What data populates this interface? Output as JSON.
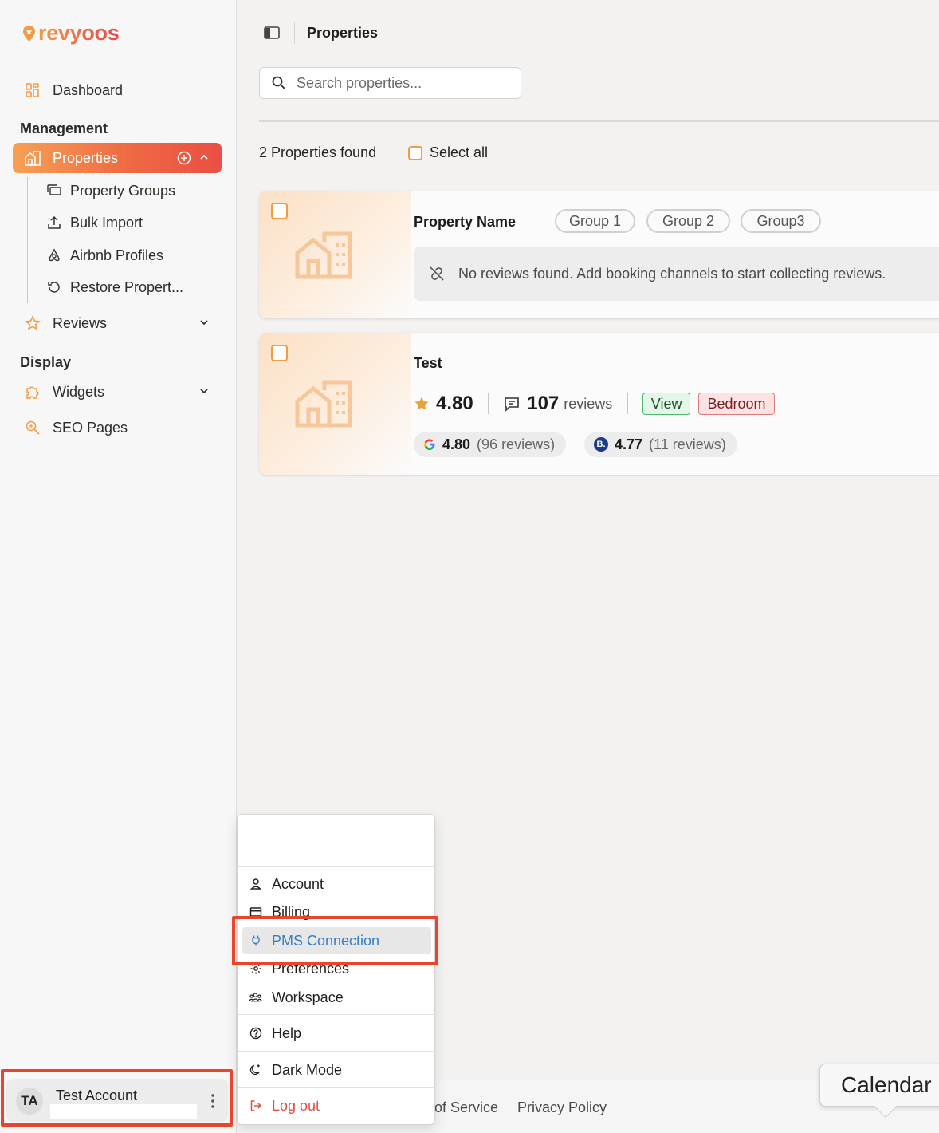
{
  "app": {
    "logo_text": "revyoos",
    "brand_color": "#f07a3a"
  },
  "sidebar": {
    "dashboard_label": "Dashboard",
    "management_title": "Management",
    "properties_label": "Properties",
    "sub_items": [
      "Property Groups",
      "Bulk Import",
      "Airbnb Profiles",
      "Restore Propert..."
    ],
    "reviews_label": "Reviews",
    "display_title": "Display",
    "widgets_label": "Widgets",
    "seo_label": "SEO Pages",
    "account": {
      "initials": "TA",
      "name": "Test Account"
    }
  },
  "header": {
    "title": "Properties"
  },
  "search": {
    "placeholder": "Search properties..."
  },
  "list": {
    "count_text": "2 Properties found",
    "select_all_label": "Select all"
  },
  "properties": [
    {
      "name": "Property Name",
      "groups": [
        "Group 1",
        "Group 2",
        "Group3"
      ],
      "notice": "No reviews found. Add booking channels to start collecting reviews."
    },
    {
      "name": "Test",
      "rating": "4.80",
      "review_count": "107",
      "review_word": "reviews",
      "tags": [
        "View",
        "Bedroom"
      ],
      "sources": [
        {
          "icon": "google-icon",
          "score": "4.80",
          "detail": "(96 reviews)"
        },
        {
          "icon": "booking-icon",
          "badge": "B.",
          "score": "4.77",
          "detail": "(11 reviews)"
        }
      ]
    }
  ],
  "footer": {
    "links": [
      "of Service",
      "Privacy Policy"
    ]
  },
  "tooltip": {
    "text": "Calendar"
  },
  "user_menu": {
    "items": [
      "Account",
      "Billing",
      "PMS Connection",
      "Preferences",
      "Workspace",
      "Help",
      "Dark Mode",
      "Log out"
    ],
    "active_item": "PMS Connection"
  },
  "colors": {
    "accent_orange": "#f39a45",
    "accent_red": "#ea4f45",
    "highlight_frame": "#e8452e",
    "link_blue": "#3a7fc1"
  }
}
